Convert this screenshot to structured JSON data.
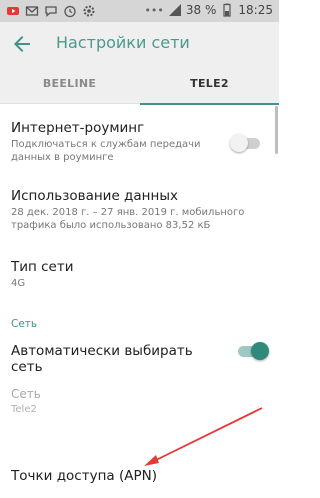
{
  "status_bar": {
    "battery_percent": "38 %",
    "time": "18:25",
    "left_icons": [
      "youtube-icon",
      "mail-icon",
      "message-icon",
      "alarm-icon",
      "settings-icon"
    ]
  },
  "app_bar": {
    "title": "Настройки сети"
  },
  "tabs": [
    {
      "label": "BEELINE",
      "selected": false
    },
    {
      "label": "TELE2",
      "selected": true
    }
  ],
  "settings": {
    "roaming": {
      "title": "Интернет-роуминг",
      "summary": "Подключаться к службам передачи данных в роуминге",
      "enabled": false
    },
    "data_usage": {
      "title": "Использование данных",
      "summary": "28 дек. 2018 г. – 27 янв. 2019 г. мобильного трафика было использовано 83,52 кБ"
    },
    "network_type": {
      "title": "Тип сети",
      "value": "4G"
    },
    "network_section": {
      "label": "Сеть"
    },
    "auto_select": {
      "title": "Автоматически выбирать сеть",
      "enabled": true
    },
    "network": {
      "title": "Сеть",
      "value": "Tele2"
    },
    "apn": {
      "title": "Точки доступа (APN)"
    }
  },
  "colors": {
    "accent": "#3f9487",
    "title_color": "#4a9a8e",
    "annotation_arrow": "#e53935"
  }
}
